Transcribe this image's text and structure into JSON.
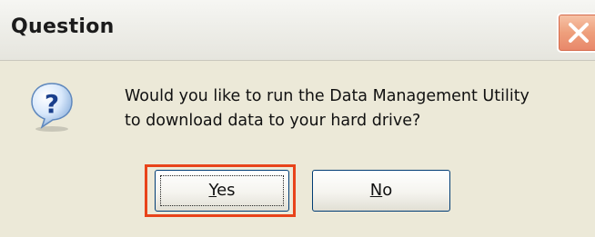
{
  "window": {
    "title": "Question",
    "close_icon": "close-icon"
  },
  "message": {
    "icon": "question-icon",
    "line1": "Would you like to run the Data Management Utility",
    "line2": "to download data to your hard drive?"
  },
  "buttons": {
    "yes_mnemonic": "Y",
    "yes_rest": "es",
    "no_mnemonic": "N",
    "no_rest": "o"
  },
  "colors": {
    "dialog_bg": "#ece9d8",
    "highlight": "#e8431a",
    "button_border": "#003c74"
  }
}
